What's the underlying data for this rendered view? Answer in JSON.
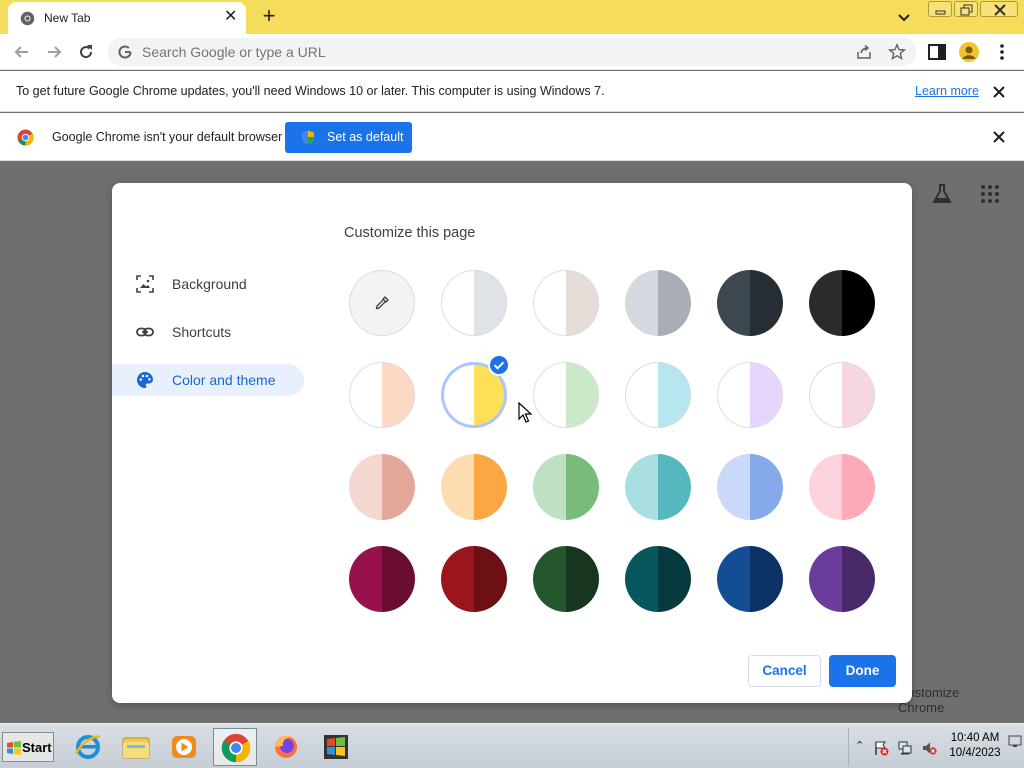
{
  "tab": {
    "title": "New Tab",
    "close_glyph": "✕"
  },
  "toolbar": {
    "omnibox_placeholder": "Search Google or type a URL",
    "new_tab_glyph": "+"
  },
  "infobar_update": {
    "message": "To get future Google Chrome updates, you'll need Windows 10 or later. This computer is using Windows 7.",
    "link": "Learn more"
  },
  "infobar_default": {
    "message": "Google Chrome isn't your default browser",
    "button": "Set as default"
  },
  "dialog": {
    "title": "Customize this page",
    "nav": [
      {
        "label": "Background",
        "icon": "image-icon"
      },
      {
        "label": "Shortcuts",
        "icon": "link-icon"
      },
      {
        "label": "Color and theme",
        "icon": "palette-icon",
        "active": true
      }
    ],
    "swatches": [
      {
        "name": "custom-color",
        "left": "#f1f3f4",
        "right": "#f1f3f4",
        "icon": "eyedropper-icon"
      },
      {
        "name": "default-light",
        "left": "#ffffff",
        "right": "#dfe3e8"
      },
      {
        "name": "warm-grey",
        "left": "#ffffff",
        "right": "#e6dcd8"
      },
      {
        "name": "cool-grey",
        "left": "#d5d8de",
        "right": "#a9adb6"
      },
      {
        "name": "dark-slate",
        "left": "#3c4750",
        "right": "#262d33"
      },
      {
        "name": "black",
        "left": "#2b2b2b",
        "right": "#000000"
      },
      {
        "name": "peach-light",
        "left": "#ffffff",
        "right": "#fcd9c5"
      },
      {
        "name": "yellow-light",
        "left": "#ffffff",
        "right": "#fddf58",
        "selected": true
      },
      {
        "name": "green-light",
        "left": "#ffffff",
        "right": "#cae9c9"
      },
      {
        "name": "cyan-light",
        "left": "#ffffff",
        "right": "#b6e6ef"
      },
      {
        "name": "lavender-light",
        "left": "#ffffff",
        "right": "#e6d5fc"
      },
      {
        "name": "pink-light",
        "left": "#ffffff",
        "right": "#f7d6e4"
      },
      {
        "name": "rose",
        "left": "#f5d7d1",
        "right": "#e3a89a"
      },
      {
        "name": "orange",
        "left": "#fddcb0",
        "right": "#fba844"
      },
      {
        "name": "green",
        "left": "#bfe1c1",
        "right": "#78bb7b"
      },
      {
        "name": "aqua",
        "left": "#a9dfe1",
        "right": "#56b8bf"
      },
      {
        "name": "blue",
        "left": "#c9d9f7",
        "right": "#86a9eb"
      },
      {
        "name": "pink",
        "left": "#fcd3dd",
        "right": "#fca9b8"
      },
      {
        "name": "crimson",
        "left": "#97114d",
        "right": "#6b0d33"
      },
      {
        "name": "red",
        "left": "#9b161c",
        "right": "#6c1014"
      },
      {
        "name": "forest",
        "left": "#24572f",
        "right": "#18361f"
      },
      {
        "name": "teal",
        "left": "#08575d",
        "right": "#053b3f"
      },
      {
        "name": "navy",
        "left": "#134d94",
        "right": "#0d3366"
      },
      {
        "name": "purple",
        "left": "#6a3d9c",
        "right": "#482a6a"
      }
    ],
    "cancel": "Cancel",
    "done": "Done"
  },
  "ntp": {
    "customize_chip": "Customize Chrome"
  },
  "taskbar": {
    "start": "Start",
    "apps": [
      "internet-explorer-icon",
      "file-explorer-icon",
      "media-player-icon",
      "chrome-icon",
      "firefox-icon",
      "windows-flag-icon"
    ],
    "time": "10:40 AM",
    "date": "10/4/2023"
  },
  "colors": {
    "accent": "#1a73e8",
    "titlebar": "#f5dc5a",
    "overlay": "#6f6f6f"
  }
}
